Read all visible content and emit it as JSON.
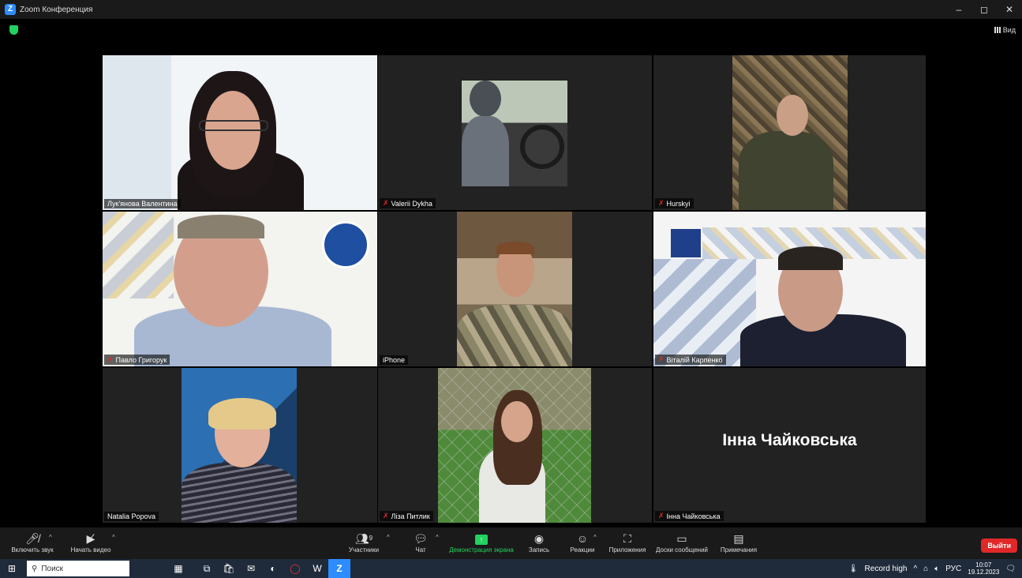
{
  "window": {
    "title": "Zoom Конференция",
    "view_label": "Вид",
    "minimize": "–",
    "maximize": "◻",
    "close": "✕"
  },
  "participants": [
    {
      "name": "Лук'янова Валентина",
      "muted": false,
      "active": true
    },
    {
      "name": "Valerii Dykha",
      "muted": true
    },
    {
      "name": "Hurskyi",
      "muted": true
    },
    {
      "name": "Павло Григорук",
      "muted": true
    },
    {
      "name": "iPhone",
      "muted": false
    },
    {
      "name": "Віталій Карпенко",
      "muted": true
    },
    {
      "name": "Natalia Popova",
      "muted": false
    },
    {
      "name": "Ліза Питлик",
      "muted": true
    },
    {
      "name": "Інна Чайковська",
      "muted": true,
      "video_off": true,
      "display_name": "Інна Чайковська"
    }
  ],
  "toolbar": {
    "audio": "Включить звук",
    "video": "Начать видео",
    "participants": "Участники",
    "participants_count": "9",
    "chat": "Чат",
    "share": "Демонстрация экрана",
    "record": "Запись",
    "reactions": "Реакции",
    "apps": "Приложения",
    "whiteboards": "Доски сообщений",
    "notes": "Примечания",
    "leave": "Выйти"
  },
  "taskbar": {
    "search_placeholder": "Поиск",
    "record_label": "Record high",
    "lang": "РУС",
    "time": "10:07",
    "date": "19.12.2023"
  },
  "colors": {
    "active_border": "#c6d95a",
    "share_green": "#23d160",
    "leave_red": "#e02828",
    "muted_red": "#e02828"
  }
}
